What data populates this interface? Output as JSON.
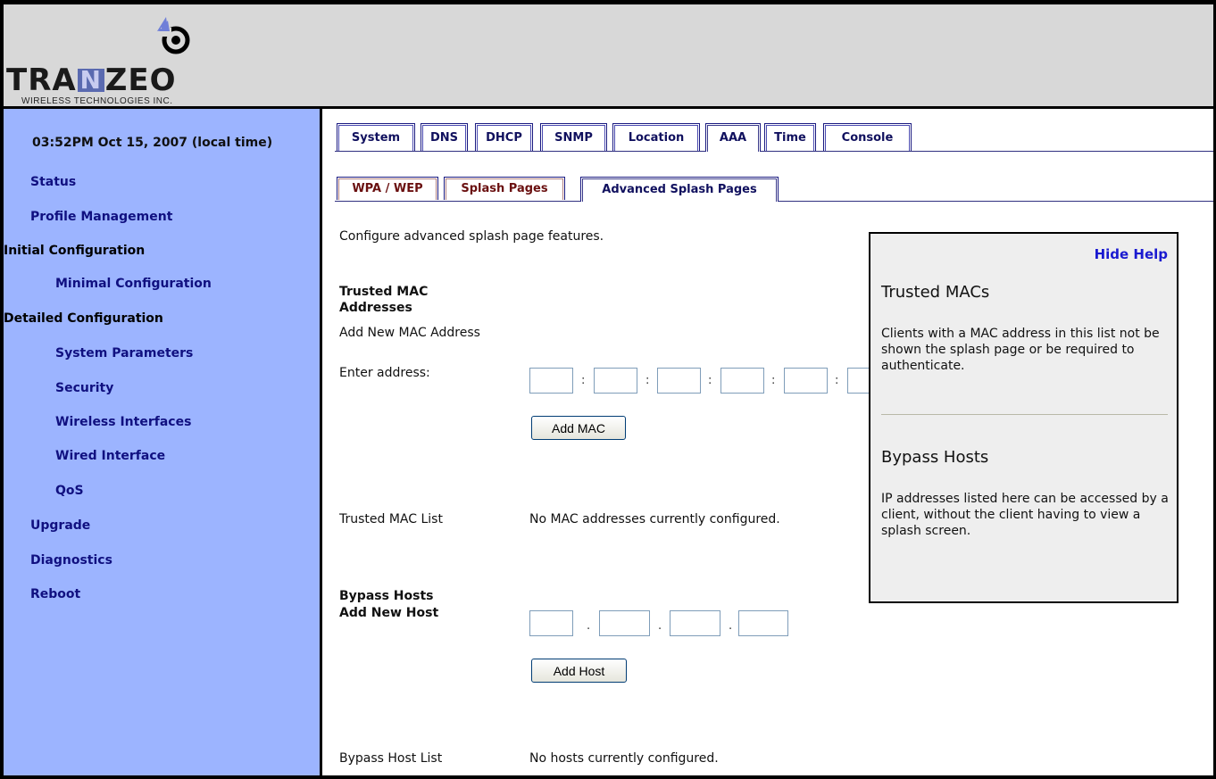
{
  "brand": {
    "name_left": "TRA",
    "name_box": "N",
    "name_right": "ZEO",
    "tagline": "WIRELESS TECHNOLOGIES INC."
  },
  "sidebar": {
    "clock": "03:52PM Oct 15, 2007 (local time)",
    "items": [
      {
        "label": "Status"
      },
      {
        "label": "Profile Management"
      },
      {
        "label": "Initial Configuration"
      },
      {
        "label": "Minimal Configuration"
      },
      {
        "label": "Detailed Configuration"
      },
      {
        "label": "System Parameters"
      },
      {
        "label": "Security"
      },
      {
        "label": "Wireless Interfaces"
      },
      {
        "label": "Wired Interface"
      },
      {
        "label": "QoS"
      },
      {
        "label": "Upgrade"
      },
      {
        "label": "Diagnostics"
      },
      {
        "label": "Reboot"
      }
    ]
  },
  "tabs": [
    {
      "label": "System"
    },
    {
      "label": "DNS"
    },
    {
      "label": "DHCP"
    },
    {
      "label": "SNMP"
    },
    {
      "label": "Location"
    },
    {
      "label": "AAA",
      "active": true
    },
    {
      "label": "Time"
    },
    {
      "label": "Console"
    }
  ],
  "subtabs": [
    {
      "label": "WPA / WEP"
    },
    {
      "label": "Splash Pages"
    },
    {
      "label": "Advanced Splash Pages",
      "active": true
    }
  ],
  "main": {
    "intro": "Configure advanced splash page features.",
    "trusted": {
      "heading_line1": "Trusted MAC",
      "heading_line2": "Addresses",
      "add_label": "Add New MAC Address",
      "enter_label": "Enter address:",
      "separator": ":",
      "add_button": "Add MAC",
      "list_label": "Trusted MAC List",
      "list_value": "No MAC addresses currently configured."
    },
    "bypass": {
      "heading": "Bypass Hosts",
      "add_label": "Add New Host",
      "separator": ".",
      "add_button": "Add Host",
      "list_label": "Bypass Host List",
      "list_value": "No hosts currently configured."
    }
  },
  "help": {
    "hide_label": "Hide Help",
    "trusted_title": "Trusted MACs",
    "trusted_text": "Clients with a MAC address in this list not be shown the splash page or be required to authenticate.",
    "bypass_title": "Bypass Hosts",
    "bypass_text": "IP addresses listed here can be accessed by a client, without the client having to view a splash screen."
  },
  "colors": {
    "sidebar_bg": "#9cb4ff",
    "header_bg": "#d8d8d8",
    "help_link": "#1a1ad0"
  }
}
